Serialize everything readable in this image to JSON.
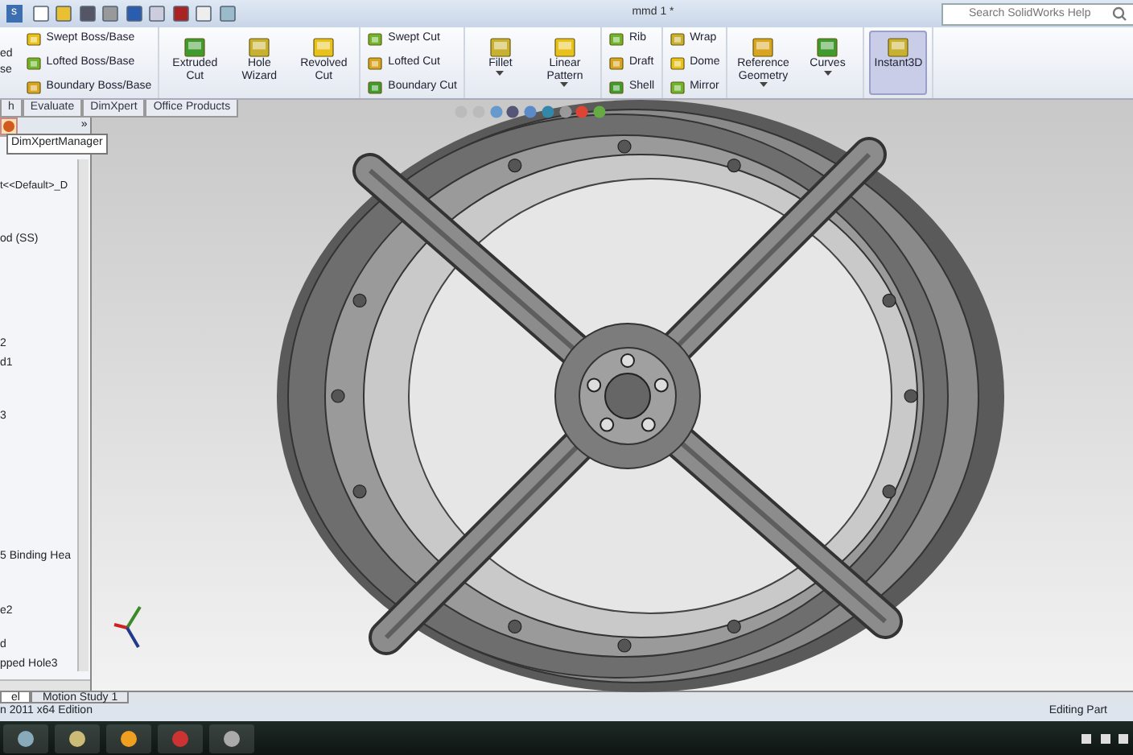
{
  "window": {
    "title": "mmd 1 *",
    "menu_partial": "s"
  },
  "search": {
    "placeholder": "Search SolidWorks Help"
  },
  "ribbon": {
    "partial_labels": [
      "ed",
      "se"
    ],
    "groups": [
      {
        "kind": "stack",
        "items": [
          {
            "label": "Swept Boss/Base"
          },
          {
            "label": "Lofted Boss/Base"
          },
          {
            "label": "Boundary Boss/Base"
          }
        ]
      },
      {
        "kind": "large",
        "items": [
          {
            "label": "Extruded Cut",
            "dropdown": false,
            "selected": false
          },
          {
            "label": "Hole Wizard",
            "dropdown": false,
            "selected": false
          },
          {
            "label": "Revolved Cut",
            "dropdown": false,
            "selected": false
          }
        ]
      },
      {
        "kind": "stack",
        "items": [
          {
            "label": "Swept Cut"
          },
          {
            "label": "Lofted Cut"
          },
          {
            "label": "Boundary Cut"
          }
        ]
      },
      {
        "kind": "large",
        "items": [
          {
            "label": "Fillet",
            "dropdown": true,
            "selected": false
          },
          {
            "label": "Linear Pattern",
            "dropdown": true,
            "selected": false
          }
        ]
      },
      {
        "kind": "stack",
        "items": [
          {
            "label": "Rib"
          },
          {
            "label": "Draft"
          },
          {
            "label": "Shell"
          }
        ]
      },
      {
        "kind": "stack",
        "items": [
          {
            "label": "Wrap"
          },
          {
            "label": "Dome"
          },
          {
            "label": "Mirror"
          }
        ]
      },
      {
        "kind": "large",
        "items": [
          {
            "label": "Reference Geometry",
            "dropdown": true,
            "selected": false
          },
          {
            "label": "Curves",
            "dropdown": true,
            "selected": false
          }
        ]
      },
      {
        "kind": "large",
        "items": [
          {
            "label": "Instant3D",
            "dropdown": false,
            "selected": true
          }
        ]
      }
    ]
  },
  "command_tabs": [
    {
      "label": "h",
      "selected": false
    },
    {
      "label": "Evaluate",
      "selected": false
    },
    {
      "label": "DimXpert",
      "selected": false
    },
    {
      "label": "Office Products",
      "selected": false
    }
  ],
  "manager": {
    "expand": "»",
    "tooltip": "DimXpertManager",
    "config": "t<<Default>_D",
    "tree": [
      "od (SS)",
      "2",
      "d1",
      "3",
      "5 Binding Hea",
      "e2",
      "d",
      "pped Hole3"
    ]
  },
  "bottom_tabs": [
    {
      "label": "el",
      "selected": true
    },
    {
      "label": "Motion Study 1",
      "selected": false
    }
  ],
  "status_bar": {
    "left": "n 2011 x64 Edition",
    "right": "Editing Part"
  }
}
